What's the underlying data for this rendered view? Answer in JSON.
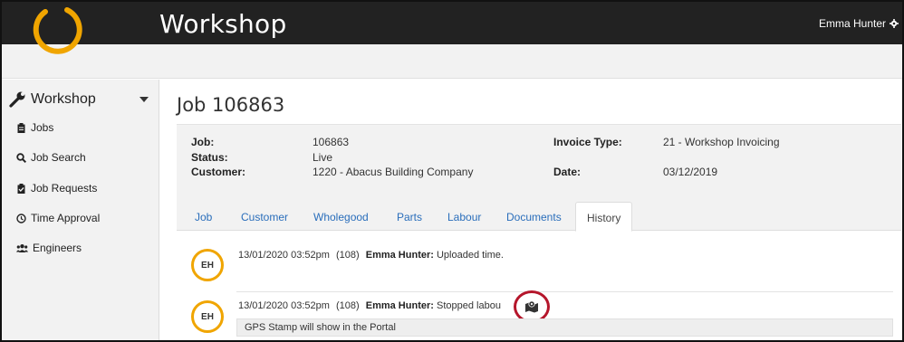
{
  "header": {
    "app_title": "Workshop",
    "user_name": "Emma Hunter",
    "user_icon": "gear-icon",
    "logo_color": "#f0a500"
  },
  "sidebar": {
    "section_label": "Workshop",
    "items": [
      {
        "label": "Jobs",
        "icon": "clipboard-icon"
      },
      {
        "label": "Job Search",
        "icon": "search-icon"
      },
      {
        "label": "Job Requests",
        "icon": "clipboard-check-icon"
      },
      {
        "label": "Time Approval",
        "icon": "clock-icon"
      },
      {
        "label": "Engineers",
        "icon": "users-icon"
      }
    ]
  },
  "page": {
    "title": "Job 106863"
  },
  "info": {
    "job_label": "Job:",
    "job_value": "106863",
    "status_label": "Status:",
    "status_value": "Live",
    "customer_label": "Customer:",
    "customer_value": "1220 - Abacus Building Company",
    "invoice_type_label": "Invoice Type:",
    "invoice_type_value": "21 - Workshop Invoicing",
    "date_label": "Date:",
    "date_value": "03/12/2019"
  },
  "tabs": [
    {
      "label": "Job",
      "active": false
    },
    {
      "label": "Customer",
      "active": false
    },
    {
      "label": "Wholegood",
      "active": false
    },
    {
      "label": "Parts",
      "active": false
    },
    {
      "label": "Labour",
      "active": false
    },
    {
      "label": "Documents",
      "active": false
    },
    {
      "label": "History",
      "active": true
    }
  ],
  "history": [
    {
      "initials": "EH",
      "timestamp": "13/01/2020 03:52pm",
      "ref": "(108)",
      "user": "Emma Hunter:",
      "message": "Uploaded time."
    },
    {
      "initials": "EH",
      "timestamp": "13/01/2020 03:52pm",
      "ref": "(108)",
      "user": "Emma Hunter:",
      "message": "Stopped labou",
      "icon": "map-marker-icon",
      "note": "GPS Stamp will show in the Portal"
    }
  ],
  "colors": {
    "topbar": "#222222",
    "accent": "#f0a500",
    "link": "#2a6ebb",
    "highlight_ring": "#b5162b"
  }
}
